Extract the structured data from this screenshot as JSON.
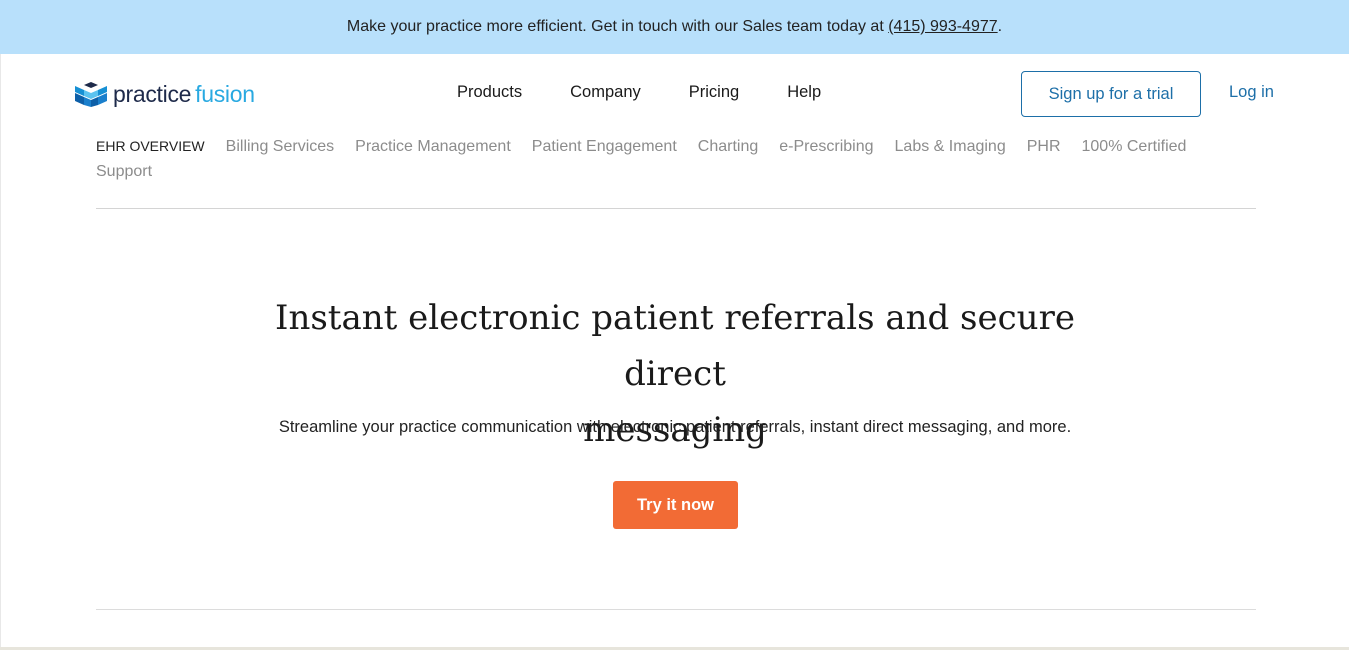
{
  "promo": {
    "text": "Make your practice more efficient. Get in touch with our Sales team today at ",
    "phone": "(415) 993-4977",
    "suffix": "."
  },
  "brand": {
    "logo_icon": "practice-fusion-cube-icon",
    "name_part1": "practice",
    "name_part2": "fusion",
    "colors": {
      "dark": "#1e2a4a",
      "accent": "#29a9e1"
    }
  },
  "main_nav": {
    "items": [
      {
        "label": "Products"
      },
      {
        "label": "Company"
      },
      {
        "label": "Pricing"
      },
      {
        "label": "Help"
      }
    ]
  },
  "header_actions": {
    "signup_label": "Sign up for a trial",
    "login_label": "Log in"
  },
  "sub_nav": {
    "items": [
      {
        "label": "EHR OVERVIEW",
        "active": true
      },
      {
        "label": "Billing Services"
      },
      {
        "label": "Practice Management"
      },
      {
        "label": "Patient Engagement"
      },
      {
        "label": "Charting"
      },
      {
        "label": "e-Prescribing"
      },
      {
        "label": "Labs & Imaging"
      },
      {
        "label": "PHR"
      },
      {
        "label": "100% Certified"
      },
      {
        "label": "Support"
      }
    ]
  },
  "hero": {
    "title_line1": "Instant electronic patient referrals and secure direct",
    "title_line2": "messaging",
    "subtitle": "Streamline your practice communication with electronic patient referrals, instant direct messaging, and more.",
    "cta_label": "Try it now",
    "cta_color": "#f26b35"
  },
  "theme": {
    "promo_bg": "#b8e0fb",
    "link_blue": "#1d6fa8"
  }
}
